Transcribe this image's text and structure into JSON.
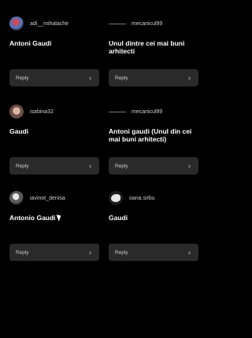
{
  "cards": [
    {
      "username": "adi__mihalache",
      "message": "Antoni Gaudi",
      "reply_label": "Reply"
    },
    {
      "username": "mecanicul99",
      "message": "Unul dintre cei mai buni arhitecti",
      "reply_label": "Reply"
    },
    {
      "username": "isabina32",
      "message": "Gaudi",
      "reply_label": "Reply"
    },
    {
      "username": "mecanicul99",
      "message": "Antoni gaudi (Unul din cei mai buni arhitecti)",
      "reply_label": "Reply"
    },
    {
      "username": "iavinot_denisa",
      "message": "Antonio Gaudi",
      "reply_label": "Reply"
    },
    {
      "username": "oana.sirbu",
      "message": "Gaudi",
      "reply_label": "Reply"
    }
  ],
  "icons": {
    "chevron": "chevron-right-icon"
  }
}
